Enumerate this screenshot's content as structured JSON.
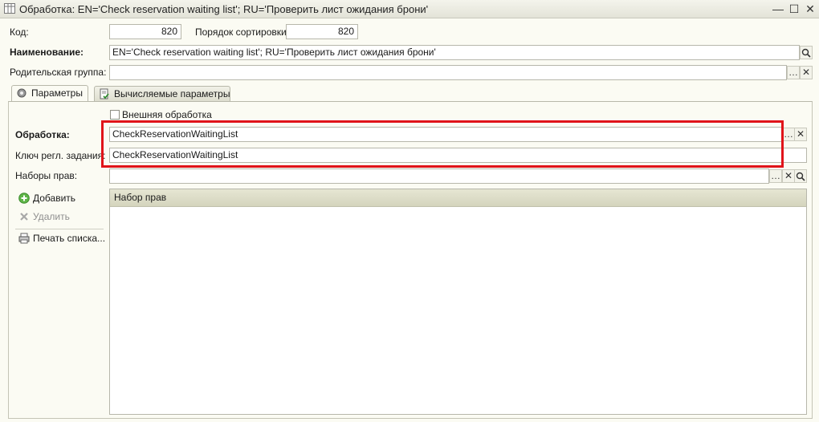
{
  "window": {
    "title": "Обработка: EN='Check reservation waiting list'; RU='Проверить лист ожидания брони'",
    "controls": [
      "minimize-icon",
      "maximize-icon",
      "close-icon"
    ]
  },
  "header": {
    "code_label": "Код:",
    "code_value": "820",
    "sort_label": "Порядок сортировки:",
    "sort_value": "820",
    "name_label": "Наименование:",
    "name_value": "EN='Check reservation waiting list'; RU='Проверить лист ожидания брони'",
    "parent_label": "Родительская группа:",
    "parent_value": ""
  },
  "tabs": [
    {
      "label": "Параметры",
      "icon": "gear-icon",
      "active": true
    },
    {
      "label": "Вычисляемые параметры",
      "icon": "document-check-icon",
      "active": false
    }
  ],
  "params": {
    "external_label": "Внешняя обработка",
    "external_checked": false,
    "processing_label": "Обработка:",
    "processing_value": "CheckReservationWaitingList",
    "job_key_label": "Ключ регл. задания:",
    "job_key_value": "CheckReservationWaitingList",
    "rights_sets_label": "Наборы прав:",
    "rights_sets_value": ""
  },
  "commands": {
    "add_label": "Добавить",
    "delete_label": "Удалить",
    "print_label": "Печать списка..."
  },
  "table": {
    "columns": [
      "Набор прав"
    ],
    "rows": []
  },
  "colors": {
    "highlight": "#e0141a",
    "background": "#fbfbf3",
    "grid_header": "#dcdcc6"
  }
}
